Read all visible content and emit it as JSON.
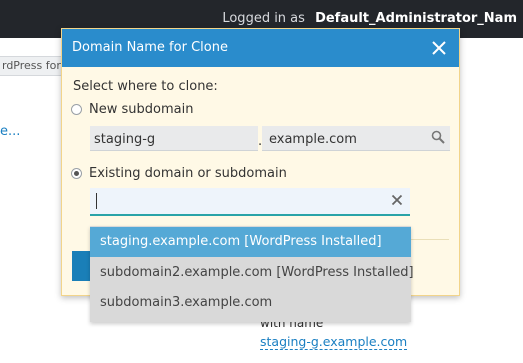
{
  "topbar": {
    "logged_in_prefix": "Logged in as",
    "username": "Default_Administrator_Nam"
  },
  "background": {
    "crumb_fragment": "rdPress for",
    "link_fragment": "e...",
    "with_name_label": "with name",
    "staging_link": "staging-g.example.com"
  },
  "dialog": {
    "title": "Domain Name for Clone",
    "prompt": "Select where to clone:",
    "option_new": "New subdomain",
    "subdomain_value": "staging-g",
    "separator": ".",
    "domain_value": "example.com",
    "option_existing": "Existing domain or subdomain",
    "combo_value": ""
  },
  "dropdown": {
    "options": [
      "staging.example.com [WordPress Installed]",
      "subdomain2.example.com [WordPress Installed]",
      "subdomain3.example.com"
    ]
  },
  "colors": {
    "header": "#2a8ccc",
    "dialog_bg": "#fff9e6",
    "selected_option": "#55a9d6",
    "focus_border": "#2aa3a8"
  }
}
